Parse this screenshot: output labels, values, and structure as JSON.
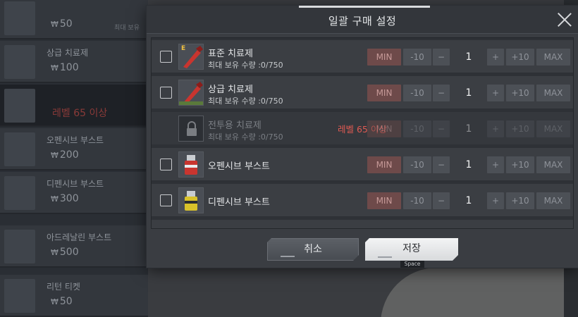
{
  "background": {
    "shop_items": [
      {
        "name": "",
        "price": "50",
        "badge": "최대 보유"
      },
      {
        "name": "상급 치료제",
        "price": "100",
        "badge": ""
      },
      {
        "name": "",
        "price": "레벨 65 이상",
        "badge": "",
        "locked": true
      },
      {
        "name": "오펜시브 부스트",
        "price": "200",
        "badge": ""
      },
      {
        "name": "디펜시브 부스트",
        "price": "300",
        "badge": ""
      },
      {
        "name": "아드레날린 부스트",
        "price": "500",
        "badge": ""
      },
      {
        "name": "리턴 티켓",
        "price": "50",
        "badge": ""
      }
    ]
  },
  "modal": {
    "title": "일괄 구매 설정",
    "items": [
      {
        "name": "표준 치료제",
        "subtitle": "최대 보유 수량 :0/750",
        "qty": "1",
        "tag": "E",
        "locked": false
      },
      {
        "name": "상급 치료제",
        "subtitle": "최대 보유 수량 :0/750",
        "qty": "1",
        "tag": "",
        "locked": false
      },
      {
        "name": "전투용 치료제",
        "subtitle": "최대 보유 수량 :0/750",
        "qty": "1",
        "tag": "",
        "locked": true,
        "lock_message": "레벨 65 이상"
      },
      {
        "name": "오펜시브 부스트",
        "subtitle": "",
        "qty": "1",
        "tag": "",
        "locked": false
      },
      {
        "name": "디펜시브 부스트",
        "subtitle": "",
        "qty": "1",
        "tag": "",
        "locked": false
      }
    ],
    "controls": {
      "min": "MIN",
      "minus10": "-10",
      "minus": "−",
      "plus": "+",
      "plus10": "+10",
      "max": "MAX"
    },
    "buttons": {
      "cancel": "취소",
      "save": "저장",
      "save_hint": "Space"
    }
  }
}
